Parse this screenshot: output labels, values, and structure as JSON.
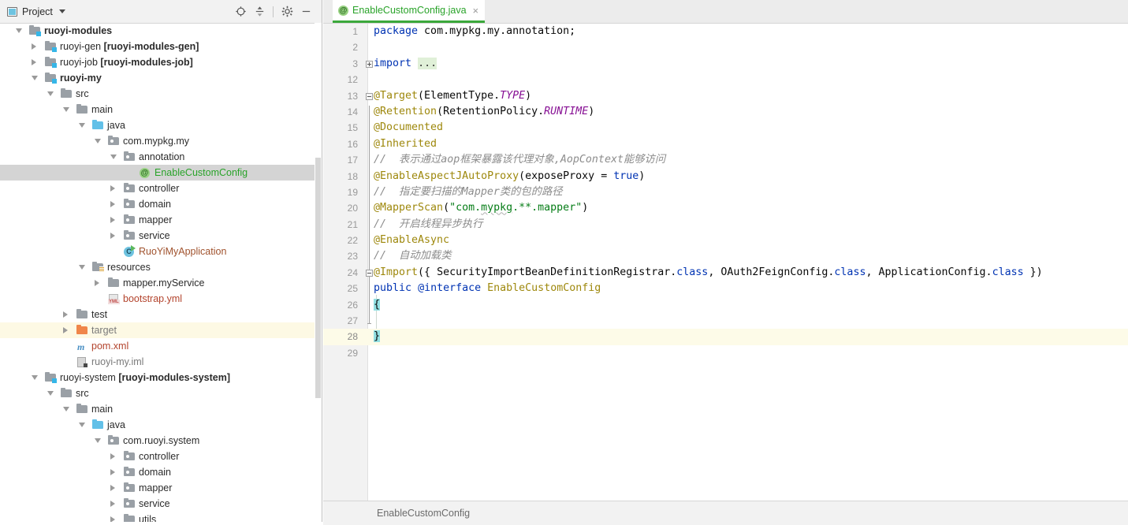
{
  "tool_window": {
    "title": "Project",
    "icons": {
      "project_icon": "project-icon",
      "dropdown": "chevron-down-icon",
      "locate": "locate-target-icon",
      "collapse_all": "collapse-all-icon",
      "settings": "gear-icon",
      "hide": "minimize-icon"
    }
  },
  "tree": {
    "items": [
      {
        "label": "ruoyi-modules",
        "bold": true,
        "indent": 0,
        "arrow": "open",
        "icon": "module-folder",
        "color": "default"
      },
      {
        "label": "ruoyi-gen ",
        "suffix": "[ruoyi-modules-gen]",
        "indent": 1,
        "arrow": "closed",
        "icon": "module-folder",
        "color": "default"
      },
      {
        "label": "ruoyi-job ",
        "suffix": "[ruoyi-modules-job]",
        "indent": 1,
        "arrow": "closed",
        "icon": "module-folder",
        "color": "default"
      },
      {
        "label": "ruoyi-my",
        "bold": true,
        "indent": 1,
        "arrow": "open",
        "icon": "module-folder",
        "color": "default"
      },
      {
        "label": "src",
        "indent": 2,
        "arrow": "open",
        "icon": "folder-gray",
        "color": "default"
      },
      {
        "label": "main",
        "indent": 3,
        "arrow": "open",
        "icon": "folder-gray",
        "color": "default"
      },
      {
        "label": "java",
        "indent": 4,
        "arrow": "open",
        "icon": "folder-source-blue",
        "color": "default"
      },
      {
        "label": "com.mypkg.my",
        "indent": 5,
        "arrow": "open",
        "icon": "package",
        "color": "default"
      },
      {
        "label": "annotation",
        "indent": 6,
        "arrow": "open",
        "icon": "package",
        "color": "default"
      },
      {
        "label": "EnableCustomConfig",
        "indent": 7,
        "arrow": "none",
        "icon": "annotation-at",
        "color": "green",
        "selected": true
      },
      {
        "label": "controller",
        "indent": 6,
        "arrow": "closed",
        "icon": "package",
        "color": "default"
      },
      {
        "label": "domain",
        "indent": 6,
        "arrow": "closed",
        "icon": "package",
        "color": "default"
      },
      {
        "label": "mapper",
        "indent": 6,
        "arrow": "closed",
        "icon": "package",
        "color": "default"
      },
      {
        "label": "service",
        "indent": 6,
        "arrow": "closed",
        "icon": "package",
        "color": "default"
      },
      {
        "label": "RuoYiMyApplication",
        "indent": 6,
        "arrow": "none",
        "icon": "class-runnable",
        "color": "brown"
      },
      {
        "label": "resources",
        "indent": 4,
        "arrow": "open",
        "icon": "folder-resources",
        "color": "default"
      },
      {
        "label": "mapper.myService",
        "indent": 5,
        "arrow": "closed",
        "icon": "folder-gray",
        "color": "default"
      },
      {
        "label": "bootstrap.yml",
        "indent": 5,
        "arrow": "none",
        "icon": "yml-file",
        "color": "red"
      },
      {
        "label": "test",
        "indent": 3,
        "arrow": "closed",
        "icon": "folder-gray",
        "color": "default"
      },
      {
        "label": "target",
        "indent": 3,
        "arrow": "closed",
        "icon": "folder-orange",
        "color": "gray",
        "excluded": true
      },
      {
        "label": "pom.xml",
        "indent": 3,
        "arrow": "none",
        "icon": "maven-file",
        "color": "red"
      },
      {
        "label": "ruoyi-my.iml",
        "indent": 3,
        "arrow": "none",
        "icon": "iml-file",
        "color": "gray"
      },
      {
        "label": "ruoyi-system ",
        "suffix": "[ruoyi-modules-system]",
        "indent": 1,
        "arrow": "open",
        "icon": "module-folder",
        "color": "default"
      },
      {
        "label": "src",
        "indent": 2,
        "arrow": "open",
        "icon": "folder-gray",
        "color": "default"
      },
      {
        "label": "main",
        "indent": 3,
        "arrow": "open",
        "icon": "folder-gray",
        "color": "default"
      },
      {
        "label": "java",
        "indent": 4,
        "arrow": "open",
        "icon": "folder-source-blue",
        "color": "default"
      },
      {
        "label": "com.ruoyi.system",
        "indent": 5,
        "arrow": "open",
        "icon": "package",
        "color": "default"
      },
      {
        "label": "controller",
        "indent": 6,
        "arrow": "closed",
        "icon": "package",
        "color": "default"
      },
      {
        "label": "domain",
        "indent": 6,
        "arrow": "closed",
        "icon": "package",
        "color": "default"
      },
      {
        "label": "mapper",
        "indent": 6,
        "arrow": "closed",
        "icon": "package",
        "color": "default"
      },
      {
        "label": "service",
        "indent": 6,
        "arrow": "closed",
        "icon": "package",
        "color": "default"
      },
      {
        "label": "utils",
        "indent": 6,
        "arrow": "closed",
        "icon": "folder-gray",
        "color": "default"
      }
    ]
  },
  "editor": {
    "tab": {
      "label": "EnableCustomConfig.java",
      "icon": "annotation-at-icon",
      "close": "×",
      "accent_color": "#3ba83b",
      "label_color": "#29a329"
    },
    "lines": [
      {
        "num": "1",
        "html": "<span class=\"k\">package</span> com.mypkg.my.annotation;"
      },
      {
        "num": "2",
        "html": ""
      },
      {
        "num": "3",
        "html": "<span class=\"k\">import</span> <span class=\"fold-ph\">...</span>",
        "fold": "plus"
      },
      {
        "num": "12",
        "html": ""
      },
      {
        "num": "13",
        "html": "<span class=\"anno\">@Target</span>(ElementType.<span class=\"stat\">TYPE</span>)",
        "fold": "minus"
      },
      {
        "num": "14",
        "html": "<span class=\"anno\">@Retention</span>(RetentionPolicy.<span class=\"stat\">RUNTIME</span>)"
      },
      {
        "num": "15",
        "html": "<span class=\"anno\">@Documented</span>"
      },
      {
        "num": "16",
        "html": "<span class=\"anno\">@Inherited</span>"
      },
      {
        "num": "17",
        "html": "<span class=\"cmt\">//  表示通过aop框架暴露该代理对象,AopContext能够访问</span>"
      },
      {
        "num": "18",
        "html": "<span class=\"anno\">@EnableAspectJAutoProxy</span>(exposeProxy = <span class=\"k\">true</span>)"
      },
      {
        "num": "19",
        "html": "<span class=\"cmt\">//  指定要扫描的Mapper类的包的路径</span>"
      },
      {
        "num": "20",
        "html": "<span class=\"anno\">@MapperScan</span>(<span class=\"str\">\"com.<span class=\"squiggle\">mypkg</span>.**.mapper\"</span>)"
      },
      {
        "num": "21",
        "html": "<span class=\"cmt\">//  开启线程异步执行</span>"
      },
      {
        "num": "22",
        "html": "<span class=\"anno\">@EnableAsync</span>"
      },
      {
        "num": "23",
        "html": "<span class=\"cmt\">//  自动加载类</span>"
      },
      {
        "num": "24",
        "html": "<span class=\"anno\">@Import</span>({ SecurityImportBeanDefinitionRegistrar.<span class=\"cls-kw\">class</span>, OAuth2FeignConfig.<span class=\"cls-kw\">class</span>, ApplicationConfig.<span class=\"cls-kw\">class</span> })",
        "fold": "minus"
      },
      {
        "num": "25",
        "html": "<span class=\"k\">public</span> <span class=\"k\">@interface</span> <span class=\"anno\">EnableCustomConfig</span>"
      },
      {
        "num": "26",
        "html": "<span class=\"brace-hl\">{</span>"
      },
      {
        "num": "27",
        "html": ""
      },
      {
        "num": "28",
        "html": "<span class=\"brace-hl\">}</span>",
        "caret": true
      },
      {
        "num": "29",
        "html": ""
      }
    ]
  },
  "status_bar": {
    "breadcrumb": "EnableCustomConfig"
  }
}
